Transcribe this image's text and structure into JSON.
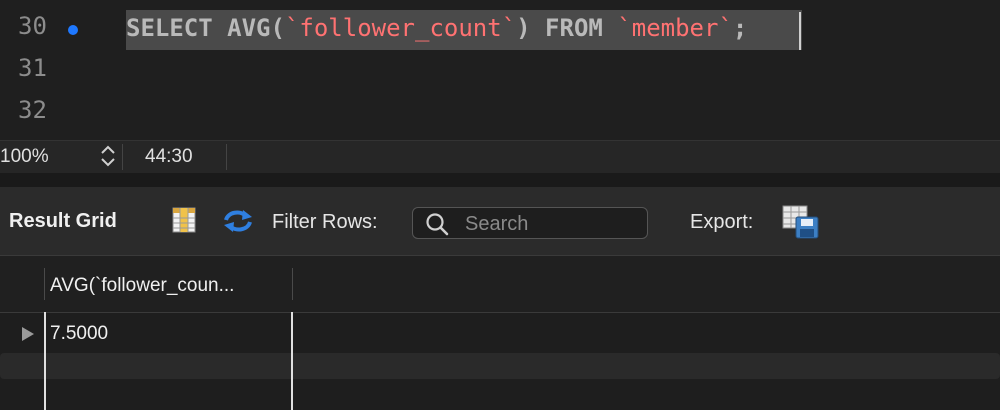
{
  "editor": {
    "lines": [
      {
        "number": "30",
        "has_marker": true
      },
      {
        "number": "31",
        "has_marker": false
      },
      {
        "number": "32",
        "has_marker": false
      }
    ],
    "sql": {
      "kw_select": "SELECT",
      "kw_avg": "AVG(",
      "column": "`follower_count`",
      "close_paren": ")",
      "kw_from": "FROM",
      "table": "`member`",
      "terminator": ";"
    }
  },
  "status_bar": {
    "zoom": "100%",
    "cursor_position": "44:30"
  },
  "toolbar": {
    "title": "Result Grid",
    "filter_label": "Filter Rows:",
    "search_placeholder": "Search",
    "search_value": "",
    "export_label": "Export:"
  },
  "icons": {
    "grid_toggle": "grid-icon",
    "refresh": "refresh-icon",
    "search": "search-icon",
    "export": "export-icon",
    "row_pointer": "play-triangle-icon",
    "marker": "breakpoint-dot-icon"
  },
  "result_grid": {
    "columns": [
      "AVG(`follower_coun..."
    ],
    "rows": [
      [
        "7.5000"
      ]
    ]
  },
  "colors": {
    "keyword": "#b9b9b9",
    "string": "#ff7272",
    "marker": "#1e78ff",
    "refresh_blue": "#2f7fe0"
  }
}
